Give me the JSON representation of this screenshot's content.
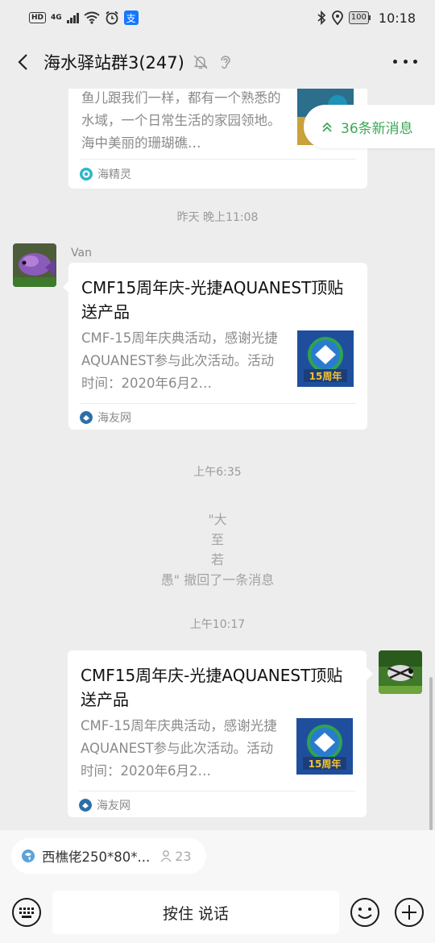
{
  "status_bar": {
    "hd": "HD",
    "network": "4G",
    "battery": "100",
    "time": "10:18",
    "alipay_char": "支"
  },
  "header": {
    "title": "海水驿站群3(247)"
  },
  "new_messages": {
    "label": "36条新消息"
  },
  "messages": [
    {
      "type": "link-card",
      "desc": "鱼儿跟我们一样，都有一个熟悉的水域，一个日常生活的家园领地。海中美丽的珊瑚礁…",
      "source": "海精灵"
    },
    {
      "type": "time",
      "text": "昨天 晚上11:08"
    },
    {
      "type": "link-card",
      "sender": "Van",
      "title": "CMF15周年庆-光捷AQUANEST顶贴送产品",
      "desc": "CMF-15周年庆典活动，感谢光捷AQUANEST参与此次活动。活动时间：2020年6月2…",
      "source": "海友网",
      "thumb_text": "15周年"
    },
    {
      "type": "time",
      "text": "上午6:35"
    },
    {
      "type": "recall",
      "lines": [
        "\"大",
        "至",
        "若",
        "愚\" 撤回了一条消息"
      ]
    },
    {
      "type": "time",
      "text": "上午10:17"
    },
    {
      "type": "link-card",
      "self": true,
      "title": "CMF15周年庆-光捷AQUANEST顶贴送产品",
      "desc": "CMF-15周年庆典活动，感谢光捷AQUANEST参与此次活动。活动时间：2020年6月2…",
      "source": "海友网",
      "thumb_text": "15周年"
    }
  ],
  "quote": {
    "text": "西樵佬250*80*...",
    "count": "23"
  },
  "input": {
    "hold_to_talk": "按住 说话"
  },
  "colors": {
    "accent_green": "#3aa856",
    "background": "#ededed",
    "card": "#ffffff"
  }
}
